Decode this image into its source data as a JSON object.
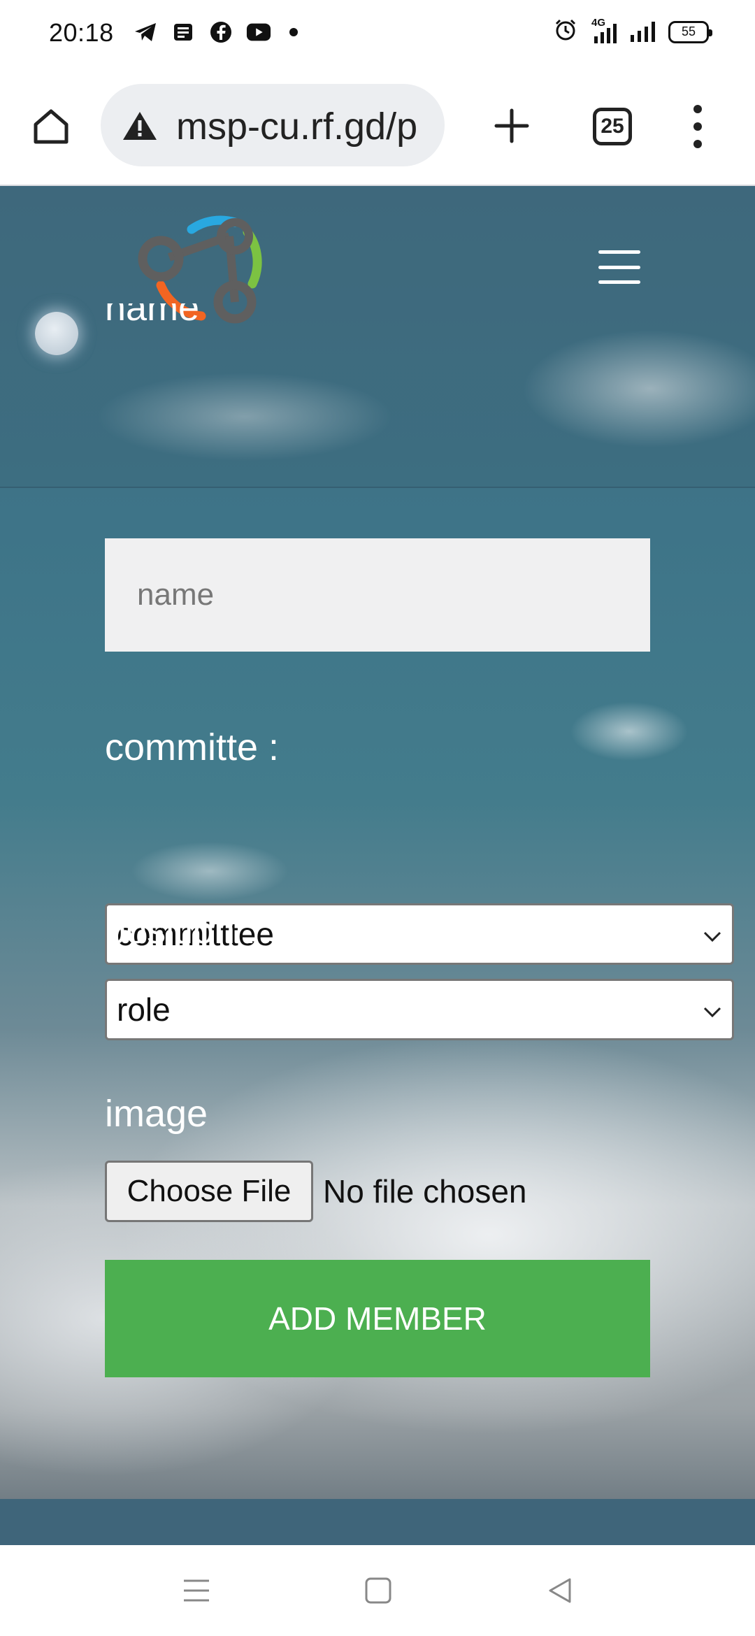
{
  "status_bar": {
    "time": "20:18",
    "notification_icons": [
      "telegram-icon",
      "news-icon",
      "facebook-icon",
      "youtube-icon"
    ],
    "network_label": "4G",
    "battery": "55"
  },
  "browser": {
    "url": "msp-cu.rf.gd/p",
    "tab_count": "25"
  },
  "form": {
    "name_label": "name",
    "name_placeholder": "name",
    "committee_label": "committe :",
    "committee_selected": "committtee",
    "position_label": "position :",
    "position_selected": "role",
    "image_label": "image",
    "file_button": "Choose File",
    "file_status": "No file chosen",
    "submit_label": "ADD MEMBER"
  },
  "colors": {
    "submit_button": "#4caf50",
    "logo_blue": "#29a8e0",
    "logo_green": "#7cc242",
    "logo_orange": "#f26522",
    "logo_gray": "#5f5f5f"
  }
}
